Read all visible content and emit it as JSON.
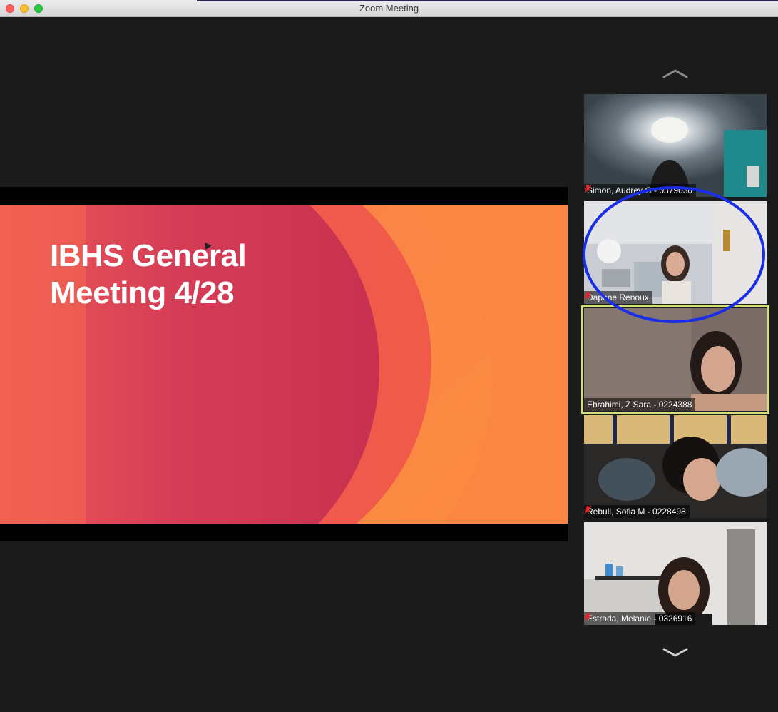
{
  "window": {
    "title": "Zoom Meeting"
  },
  "slide": {
    "title": "IBHS General\nMeeting 4/28"
  },
  "participants": [
    {
      "name": "Simon, Audrey G - 0379030",
      "muted": true,
      "active": false
    },
    {
      "name": "Daphne Renoux",
      "muted": true,
      "active": false
    },
    {
      "name": "Ebrahimi, Z Sara - 0224388",
      "muted": false,
      "active": true
    },
    {
      "name": "Rebull, Sofia M - 0228498",
      "muted": true,
      "active": false
    },
    {
      "name": "Estrada, Melanie - 0326916",
      "muted": true,
      "active": false
    }
  ],
  "colors": {
    "active_speaker_border": "#d3e07a",
    "annotation_ellipse": "#1a2ee8",
    "mute_icon": "#e0242b"
  },
  "icons": {
    "scroll_up": "chevron-up-icon",
    "scroll_down": "chevron-down-icon",
    "muted": "microphone-muted-icon"
  }
}
